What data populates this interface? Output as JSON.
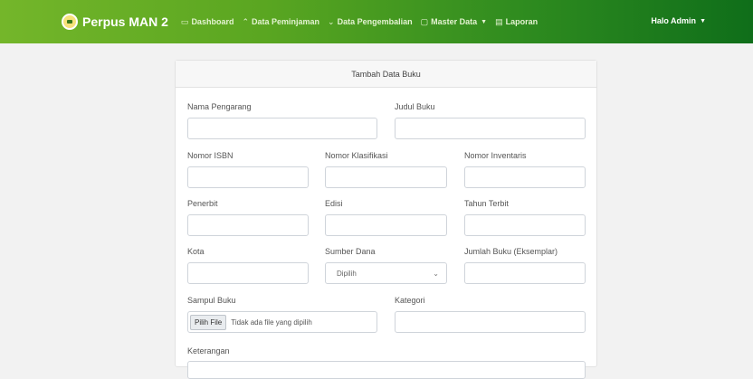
{
  "navbar": {
    "brand": "Perpus MAN 2",
    "items": [
      {
        "label": "Dashboard",
        "icon": "monitor-icon"
      },
      {
        "label": "Data Peminjaman",
        "icon": "arrow-up-icon"
      },
      {
        "label": "Data Pengembalian",
        "icon": "arrow-down-icon"
      },
      {
        "label": "Master Data",
        "icon": "folder-icon"
      },
      {
        "label": "Laporan",
        "icon": "document-icon"
      }
    ],
    "user": "Halo Admin"
  },
  "form": {
    "title": "Tambah Data Buku",
    "nama_pengarang": {
      "label": "Nama Pengarang",
      "value": ""
    },
    "judul_buku": {
      "label": "Judul Buku",
      "value": ""
    },
    "nomor_isbn": {
      "label": "Nomor ISBN",
      "value": ""
    },
    "nomor_klasifikasi": {
      "label": "Nomor Klasifikasi",
      "value": ""
    },
    "nomor_inventaris": {
      "label": "Nomor Inventaris",
      "value": ""
    },
    "penerbit": {
      "label": "Penerbit",
      "value": ""
    },
    "edisi": {
      "label": "Edisi",
      "value": ""
    },
    "tahun_terbit": {
      "label": "Tahun Terbit",
      "value": ""
    },
    "kota": {
      "label": "Kota",
      "value": ""
    },
    "sumber_dana": {
      "label": "Sumber Dana",
      "selected": "Dipilih"
    },
    "jumlah_buku": {
      "label": "Jumlah Buku (Eksemplar)",
      "value": ""
    },
    "sampul_buku": {
      "label": "Sampul Buku",
      "button": "Pilih File",
      "status": "Tidak ada file yang dipilih"
    },
    "kategori": {
      "label": "Kategori",
      "value": ""
    },
    "keterangan": {
      "label": "Keterangan"
    }
  },
  "colors": {
    "navbar_start": "#74b62a",
    "navbar_end": "#0f6e1a"
  }
}
